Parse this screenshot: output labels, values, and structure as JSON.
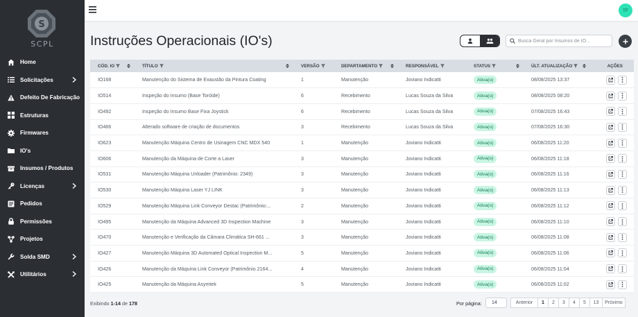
{
  "brand": {
    "name": "SCPL"
  },
  "sidebar": {
    "items": [
      {
        "label": "Home",
        "icon": "home-icon",
        "chevron": false
      },
      {
        "label": "Solicitações",
        "icon": "list-icon",
        "chevron": true
      },
      {
        "label": "Defeito De Fabricação",
        "icon": "warning-icon",
        "chevron": false
      },
      {
        "label": "Estruturas",
        "icon": "structure-icon",
        "chevron": false
      },
      {
        "label": "Firmwares",
        "icon": "gear-icon",
        "chevron": false
      },
      {
        "label": "IO's",
        "icon": "folder-icon",
        "chevron": false
      },
      {
        "label": "Insumos / Produtos",
        "icon": "box-icon",
        "chevron": false
      },
      {
        "label": "Licenças",
        "icon": "key-icon",
        "chevron": true
      },
      {
        "label": "Pedidos",
        "icon": "orders-icon",
        "chevron": false
      },
      {
        "label": "Permissões",
        "icon": "lock-icon",
        "chevron": false
      },
      {
        "label": "Projetos",
        "icon": "project-icon",
        "chevron": false
      },
      {
        "label": "Solda SMD",
        "icon": "wrench-icon",
        "chevron": true
      },
      {
        "label": "Utilitários",
        "icon": "tools-icon",
        "chevron": true
      }
    ]
  },
  "topbar": {
    "avatar_initials": "TF"
  },
  "page": {
    "title": "Instruções Operacionais (IO's)",
    "search_placeholder": "Busca Geral por Insumos de IO..."
  },
  "table": {
    "headers": {
      "code": "CÓD. IO",
      "title": "TÍTULO",
      "version": "VERSÃO",
      "department": "DEPARTAMENTO",
      "responsible": "RESPONSÁVEL",
      "status": "STATUS",
      "updated": "ÚLT. ATUALIZAÇÃO",
      "actions": "AÇÕES"
    },
    "rows": [
      {
        "code": "IO168",
        "title": "Manutenção do Sistema de Exaustão da Pintura Coating",
        "version": "1",
        "department": "Manutenção",
        "responsible": "Joviano Indicatti",
        "status": "Ativa(o)",
        "updated": "08/08/2025 13:37"
      },
      {
        "code": "IO514",
        "title": "Inspeção do Insumo (Base Toróide)",
        "version": "6",
        "department": "Recebimento",
        "responsible": "Lucas Souza da Silva",
        "status": "Ativa(o)",
        "updated": "08/08/2025 08:20"
      },
      {
        "code": "IO492",
        "title": "Inspeção do Insumo Base Fixa Joystick",
        "version": "6",
        "department": "Recebimento",
        "responsible": "Lucas Souza da Silva",
        "status": "Ativa(o)",
        "updated": "07/08/2025 16:43"
      },
      {
        "code": "IO466",
        "title": "Alterado software de criação de documentos",
        "version": "3",
        "department": "Recebimento",
        "responsible": "Lucas Souza da Silva",
        "status": "Ativa(o)",
        "updated": "07/08/2025 16:30"
      },
      {
        "code": "IO623",
        "title": "Manutenção Máquina Centro de Usinagem CNC MDX 540",
        "version": "1",
        "department": "Manutenção",
        "responsible": "Joviano Indicatti",
        "status": "Ativa(o)",
        "updated": "06/08/2025 11:20"
      },
      {
        "code": "IO606",
        "title": "Manutenção da Máquina de Corte a Laser",
        "version": "3",
        "department": "Manutenção",
        "responsible": "Joviano Indicatti",
        "status": "Ativa(o)",
        "updated": "06/08/2025 11:18"
      },
      {
        "code": "IO531",
        "title": "Manutenção Máquina Unloader (Patrimônio: 2349)",
        "version": "3",
        "department": "Manutenção",
        "responsible": "Joviano Indicatti",
        "status": "Ativa(o)",
        "updated": "06/08/2025 11:16"
      },
      {
        "code": "IO530",
        "title": "Manutenção Máquina Laser YJ LINK",
        "version": "3",
        "department": "Manutenção",
        "responsible": "Joviano Indicatti",
        "status": "Ativa(o)",
        "updated": "06/08/2025 11:13"
      },
      {
        "code": "IO529",
        "title": "Manutenção Máquina Link Conveyor Destac (Patrimônio:...",
        "version": "2",
        "department": "Manutenção",
        "responsible": "Joviano Indicatti",
        "status": "Ativa(o)",
        "updated": "06/08/2025 11:12"
      },
      {
        "code": "IO495",
        "title": "Manutenção da Máquina Advanced 3D Inspection Machine",
        "version": "3",
        "department": "Manutenção",
        "responsible": "Joviano Indicatti",
        "status": "Ativa(o)",
        "updated": "06/08/2025 11:10"
      },
      {
        "code": "IO470",
        "title": "Manutenção e Verificação da Câmara Climática SH-661 ...",
        "version": "3",
        "department": "Manutenção",
        "responsible": "Joviano Indicatti",
        "status": "Ativa(o)",
        "updated": "06/08/2025 11:08"
      },
      {
        "code": "IO427",
        "title": "Manutenção Máquina 3D Automated Optical Inspection M...",
        "version": "5",
        "department": "Manutenção",
        "responsible": "Joviano Indicatti",
        "status": "Ativa(o)",
        "updated": "06/08/2025 11:06"
      },
      {
        "code": "IO426",
        "title": "Manutenção da Máquina Link Conveyor (Patrimônio 2164...",
        "version": "4",
        "department": "Manutenção",
        "responsible": "Joviano Indicatti",
        "status": "Ativa(o)",
        "updated": "06/08/2025 11:04"
      },
      {
        "code": "IO425",
        "title": "Manutenção da Máquina Asymtek",
        "version": "5",
        "department": "Manutenção",
        "responsible": "Joviano Indicatti",
        "status": "Ativa(o)",
        "updated": "06/08/2025 11:02"
      }
    ]
  },
  "footer": {
    "showing_prefix": "Exibindo",
    "range": "1-14",
    "of_label": "de",
    "total": "178",
    "per_page_label": "Por página:",
    "per_page_value": "14",
    "prev_label": "Anterior",
    "pages": [
      "1",
      "2",
      "3",
      "4",
      "5",
      "13"
    ],
    "current_page": "1",
    "next_label": "Próximo"
  },
  "colors": {
    "sidebar_bg": "#2b2f34",
    "status_bg": "#c9f5e3",
    "status_text": "#117a55",
    "avatar_bg": "#2de2b5",
    "header_bg": "#d8dde3"
  }
}
